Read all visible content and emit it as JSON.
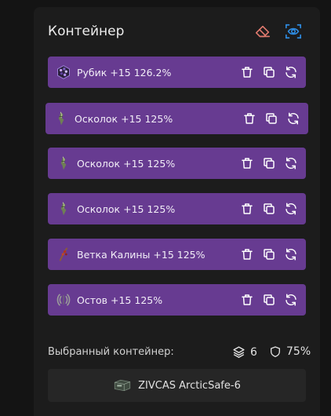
{
  "panel": {
    "title": "Контейнер",
    "icons": [
      "eraser-icon",
      "eye-icon"
    ]
  },
  "items": [
    {
      "icon": "rubik-cube-icon",
      "name": "Рубик",
      "level": "+15",
      "percent": "126.2%"
    },
    {
      "icon": "shard-icon",
      "name": "Осколок",
      "level": "+15",
      "percent": "125%"
    },
    {
      "icon": "shard-icon",
      "name": "Осколок",
      "level": "+15",
      "percent": "125%"
    },
    {
      "icon": "shard-icon",
      "name": "Осколок",
      "level": "+15",
      "percent": "125%"
    },
    {
      "icon": "branch-icon",
      "name": "Ветка Калины",
      "level": "+15",
      "percent": "125%"
    },
    {
      "icon": "skeleton-icon",
      "name": "Остов",
      "level": "+15",
      "percent": "125%"
    }
  ],
  "item_actions": [
    "trash-icon",
    "copy-icon",
    "sync-icon"
  ],
  "selected": {
    "label": "Выбранный контейнер:",
    "slots": "6",
    "protection": "75%",
    "container_name": "ZIVCAS ArcticSafe-6"
  },
  "colors": {
    "item_bg": "#673b91",
    "accent_blue": "#2e8be0",
    "eraser": "#e07a6e"
  }
}
